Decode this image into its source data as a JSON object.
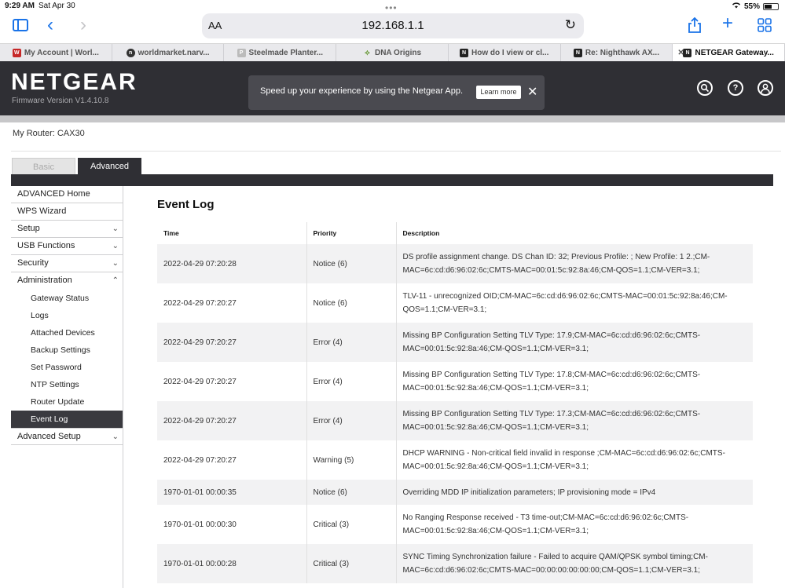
{
  "status_bar": {
    "time": "9:29 AM",
    "date": "Sat Apr 30",
    "battery": "55%"
  },
  "browser": {
    "font_size_label": "AA",
    "url": "192.168.1.1",
    "tabs": [
      {
        "label": "My Account | Worl...",
        "favicon": "wm"
      },
      {
        "label": "worldmarket.narv...",
        "favicon": "nv"
      },
      {
        "label": "Steelmade Planter...",
        "favicon": "P"
      },
      {
        "label": "DNA Origins",
        "favicon": "dna"
      },
      {
        "label": "How do I view or cl...",
        "favicon": "N"
      },
      {
        "label": "Re: Nighthawk AX...",
        "favicon": "N"
      },
      {
        "label": "NETGEAR Gateway...",
        "favicon": "N"
      }
    ]
  },
  "header": {
    "logo": "NETGEAR",
    "firmware": "Firmware Version V1.4.10.8",
    "banner_text": "Speed up your experience by using the Netgear App.",
    "banner_button": "Learn more"
  },
  "router_label": "My Router: CAX30",
  "mode_tabs": {
    "basic": "Basic",
    "advanced": "Advanced"
  },
  "nav": {
    "items": [
      {
        "label": "ADVANCED Home",
        "expand": ""
      },
      {
        "label": "WPS Wizard",
        "expand": ""
      },
      {
        "label": "Setup",
        "expand": "⌄"
      },
      {
        "label": "USB Functions",
        "expand": "⌄"
      },
      {
        "label": "Security",
        "expand": "⌄"
      },
      {
        "label": "Administration",
        "expand": "⌃"
      }
    ],
    "sub_items": [
      "Gateway Status",
      "Logs",
      "Attached Devices",
      "Backup Settings",
      "Set Password",
      "NTP Settings",
      "Router Update",
      "Event Log"
    ],
    "after": {
      "label": "Advanced Setup",
      "expand": "⌄"
    }
  },
  "page_title": "Event Log",
  "table": {
    "headers": [
      "Time",
      "Priority",
      "Description"
    ],
    "rows": [
      {
        "time": "2022-04-29 07:20:28",
        "priority": "Notice (6)",
        "description": "DS profile assignment change. DS Chan ID: 32; Previous Profile: ; New Profile: 1 2.;CM-MAC=6c:cd:d6:96:02:6c;CMTS-MAC=00:01:5c:92:8a:46;CM-QOS=1.1;CM-VER=3.1;"
      },
      {
        "time": "2022-04-29 07:20:27",
        "priority": "Notice (6)",
        "description": "TLV-11 - unrecognized OID;CM-MAC=6c:cd:d6:96:02:6c;CMTS-MAC=00:01:5c:92:8a:46;CM-QOS=1.1;CM-VER=3.1;"
      },
      {
        "time": "2022-04-29 07:20:27",
        "priority": "Error (4)",
        "description": "Missing BP Configuration Setting TLV Type: 17.9;CM-MAC=6c:cd:d6:96:02:6c;CMTS-MAC=00:01:5c:92:8a:46;CM-QOS=1.1;CM-VER=3.1;"
      },
      {
        "time": "2022-04-29 07:20:27",
        "priority": "Error (4)",
        "description": "Missing BP Configuration Setting TLV Type: 17.8;CM-MAC=6c:cd:d6:96:02:6c;CMTS-MAC=00:01:5c:92:8a:46;CM-QOS=1.1;CM-VER=3.1;"
      },
      {
        "time": "2022-04-29 07:20:27",
        "priority": "Error (4)",
        "description": "Missing BP Configuration Setting TLV Type: 17.3;CM-MAC=6c:cd:d6:96:02:6c;CMTS-MAC=00:01:5c:92:8a:46;CM-QOS=1.1;CM-VER=3.1;"
      },
      {
        "time": "2022-04-29 07:20:27",
        "priority": "Warning (5)",
        "description": "DHCP WARNING - Non-critical field invalid in response ;CM-MAC=6c:cd:d6:96:02:6c;CMTS-MAC=00:01:5c:92:8a:46;CM-QOS=1.1;CM-VER=3.1;"
      },
      {
        "time": "1970-01-01 00:00:35",
        "priority": "Notice (6)",
        "description": "Overriding MDD IP initialization parameters; IP provisioning mode = IPv4"
      },
      {
        "time": "1970-01-01 00:00:30",
        "priority": "Critical (3)",
        "description": "No Ranging Response received - T3 time-out;CM-MAC=6c:cd:d6:96:02:6c;CMTS-MAC=00:01:5c:92:8a:46;CM-QOS=1.1;CM-VER=3.1;"
      },
      {
        "time": "1970-01-01 00:00:28",
        "priority": "Critical (3)",
        "description": "SYNC Timing Synchronization failure - Failed to acquire QAM/QPSK symbol timing;CM-MAC=6c:cd:d6:96:02:6c;CMTS-MAC=00:00:00:00:00:00;CM-QOS=1.1;CM-VER=3.1;"
      }
    ]
  },
  "colors": {
    "header_bg": "#2f2f34",
    "accent_blue": "#1a73e8"
  }
}
